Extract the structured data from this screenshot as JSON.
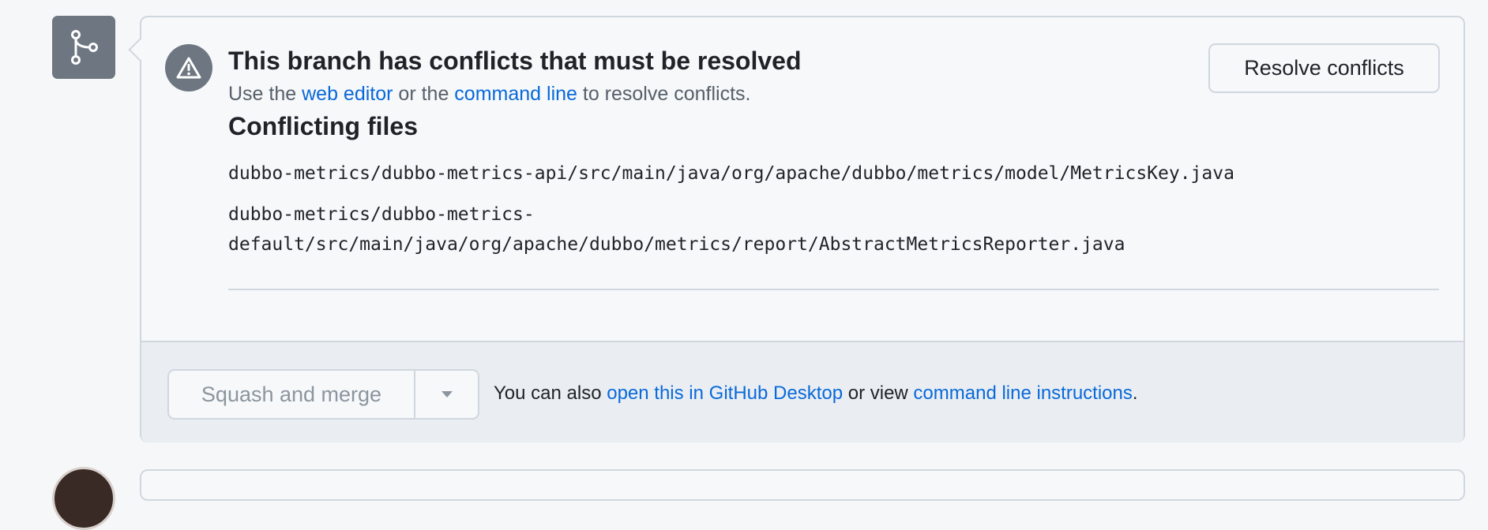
{
  "conflict": {
    "title": "This branch has conflicts that must be resolved",
    "subtitle_prefix": "Use the ",
    "web_editor_link": "web editor",
    "subtitle_middle": " or the ",
    "command_line_link": "command line",
    "subtitle_suffix": " to resolve conflicts.",
    "files_heading": "Conflicting files",
    "files": [
      "dubbo-metrics/dubbo-metrics-api/src/main/java/org/apache/dubbo/metrics/model/MetricsKey.java",
      "dubbo-metrics/dubbo-metrics-",
      "default/src/main/java/org/apache/dubbo/metrics/report/AbstractMetricsReporter.java"
    ],
    "resolve_button": "Resolve conflicts"
  },
  "merge": {
    "squash_button": "Squash and merge",
    "also_prefix": "You can also ",
    "desktop_link": "open this in GitHub Desktop",
    "also_middle": " or view ",
    "instructions_link": "command line instructions",
    "also_suffix": "."
  },
  "icons": {
    "merge_box_icon": "git-branch-icon",
    "alert_icon": "alert-triangle-icon",
    "dropdown_icon": "triangle-down-icon"
  },
  "colors": {
    "link": "#0969da",
    "icon_bg": "#6e7781",
    "border": "#d0d7de"
  }
}
